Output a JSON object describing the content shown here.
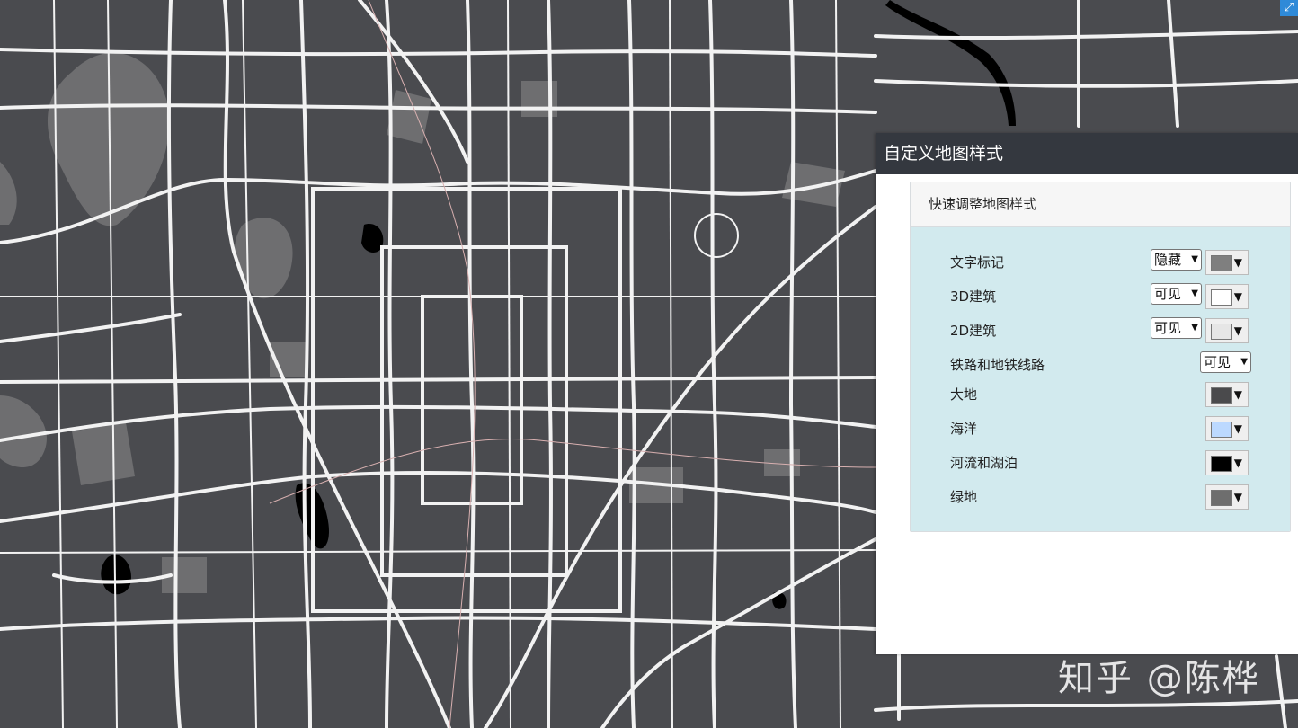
{
  "map": {
    "land_color": "#4a4b4f",
    "green_color": "#6e6e70",
    "road_color": "#f2f2f2",
    "water_color": "#000000"
  },
  "expand_icon": "expand-icon",
  "panel": {
    "title": "自定义地图样式",
    "card_title": "快速调整地图样式",
    "rows": [
      {
        "label": "文字标记",
        "select": "隐藏",
        "color": "#7f7f7f"
      },
      {
        "label": "3D建筑",
        "select": "可见",
        "color": "#ffffff"
      },
      {
        "label": "2D建筑",
        "select": "可见",
        "color": "#e6e6e6"
      },
      {
        "label": "铁路和地铁线路",
        "select": "可见"
      },
      {
        "label": "大地",
        "color": "#4a4a4c"
      },
      {
        "label": "海洋",
        "color": "#bcd9ff"
      },
      {
        "label": "河流和湖泊",
        "color": "#000000"
      },
      {
        "label": "绿地",
        "color": "#6e6e6e"
      }
    ],
    "caret_icon": "dropdown-caret-icon"
  },
  "watermark": "知乎 @陈桦"
}
